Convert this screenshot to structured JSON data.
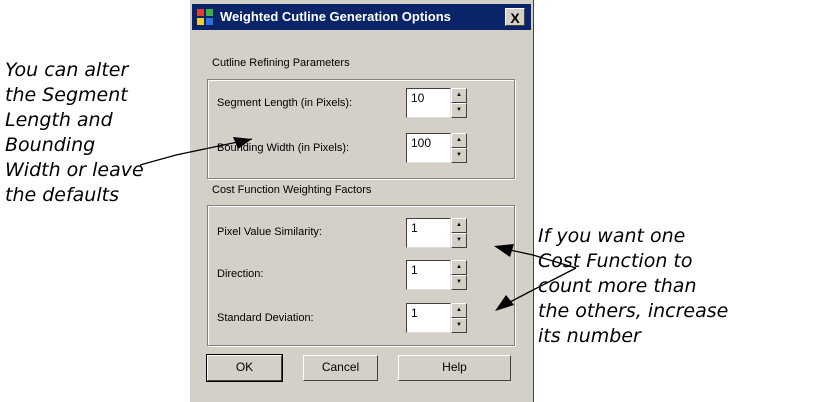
{
  "dialog": {
    "title": "Weighted Cutline Generation Options",
    "close_label": "X",
    "refining": {
      "label": "Cutline Refining Parameters",
      "fields": [
        {
          "label": "Segment Length (in Pixels):",
          "value": "10"
        },
        {
          "label": "Bounding Width (in Pixels):",
          "value": "100"
        }
      ]
    },
    "weighting": {
      "label": "Cost Function Weighting Factors",
      "fields": [
        {
          "label": "Pixel Value Similarity:",
          "value": "1"
        },
        {
          "label": "Direction:",
          "value": "1"
        },
        {
          "label": "Standard Deviation:",
          "value": "1"
        }
      ]
    },
    "buttons": {
      "ok": "OK",
      "cancel": "Cancel",
      "help": "Help"
    }
  },
  "annotations": {
    "left": [
      "You can alter",
      "the Segment",
      "Length and",
      "Bounding",
      "Width or leave",
      "the defaults"
    ],
    "right": [
      "If you want one",
      "Cost Function to",
      "count more than",
      "the others, increase",
      "its number"
    ]
  }
}
